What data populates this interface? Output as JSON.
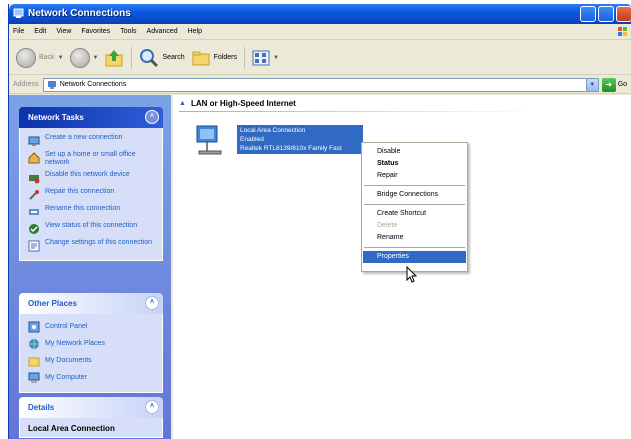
{
  "window": {
    "title": "Network Connections",
    "menu": [
      "File",
      "Edit",
      "View",
      "Favorites",
      "Tools",
      "Advanced",
      "Help"
    ]
  },
  "toolbar": {
    "back_label": "Back",
    "search_label": "Search",
    "folders_label": "Folders"
  },
  "address": {
    "label": "Address",
    "value": "Network Connections",
    "go_label": "Go"
  },
  "sidebar": {
    "network_tasks": {
      "title": "Network Tasks",
      "items": [
        {
          "label": "Create a new connection",
          "icon": "new-connection-icon"
        },
        {
          "label": "Set up a home or small office network",
          "icon": "home-network-icon"
        },
        {
          "label": "Disable this network device",
          "icon": "disable-device-icon"
        },
        {
          "label": "Repair this connection",
          "icon": "repair-icon"
        },
        {
          "label": "Rename this connection",
          "icon": "rename-icon"
        },
        {
          "label": "View status of this connection",
          "icon": "status-icon"
        },
        {
          "label": "Change settings of this connection",
          "icon": "settings-icon"
        }
      ]
    },
    "other_places": {
      "title": "Other Places",
      "items": [
        {
          "label": "Control Panel",
          "icon": "control-panel-icon"
        },
        {
          "label": "My Network Places",
          "icon": "network-places-icon"
        },
        {
          "label": "My Documents",
          "icon": "documents-folder-icon"
        },
        {
          "label": "My Computer",
          "icon": "computer-icon"
        }
      ]
    },
    "details": {
      "title": "Details",
      "subtitle": "Local Area Connection"
    }
  },
  "main": {
    "group_title": "LAN or High-Speed Internet",
    "connection": {
      "name": "Local Area Connection",
      "status": "Enabled",
      "device": "Realtek RTL8139/810x Family Fast"
    }
  },
  "context_menu": {
    "items": [
      {
        "label": "Disable",
        "style": "normal"
      },
      {
        "label": "Status",
        "style": "bold"
      },
      {
        "label": "Repair",
        "style": "normal"
      },
      {
        "label": "-",
        "style": "separator"
      },
      {
        "label": "Bridge Connections",
        "style": "normal"
      },
      {
        "label": "-",
        "style": "separator"
      },
      {
        "label": "Create Shortcut",
        "style": "normal"
      },
      {
        "label": "Delete",
        "style": "disabled"
      },
      {
        "label": "Rename",
        "style": "normal"
      },
      {
        "label": "-",
        "style": "separator"
      },
      {
        "label": "Properties",
        "style": "selected"
      }
    ]
  },
  "colors": {
    "titlebar": "#0a5ae0",
    "sidebar": "#7ba2e7",
    "selection": "#316ac5",
    "link": "#215dc6"
  }
}
